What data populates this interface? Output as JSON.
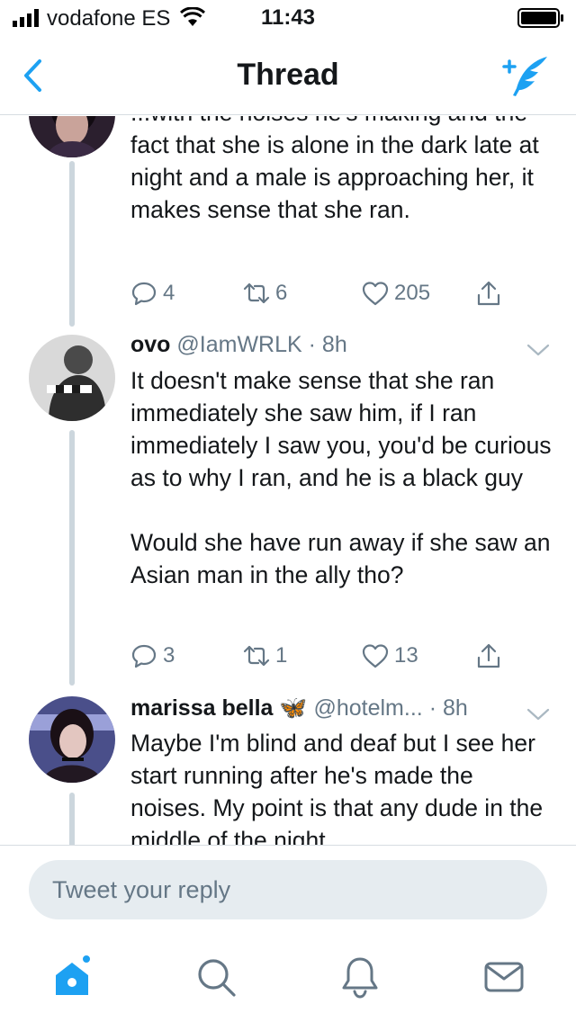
{
  "status_bar": {
    "carrier": "vodafone ES",
    "time": "11:43"
  },
  "nav": {
    "title": "Thread",
    "back_icon": "chevron-left-icon",
    "compose_icon": "compose-tweet-icon"
  },
  "tweets": [
    {
      "text": [
        "...with the noises he's making and the fact that she is alone in the dark late at night and a male is approaching her, it makes sense that she ran."
      ],
      "replies": "4",
      "retweets": "6",
      "likes": "205"
    },
    {
      "name": "ovo",
      "handle": "@IamWRLK",
      "time": "· 8h",
      "text": [
        "It doesn't make sense that she ran immediately she saw him, if I ran immediately I saw you, you'd be curious as to why I ran, and he is a black guy",
        "Would she have run away if she saw an Asian man in the ally tho?"
      ],
      "replies": "3",
      "retweets": "1",
      "likes": "13"
    },
    {
      "name": "marissa bella 🦋",
      "handle": "@hotelm...",
      "time": "· 8h",
      "text": [
        "Maybe I'm blind and deaf but I see her start running after he's made the noises. My point is that any dude in the middle of the night"
      ]
    }
  ],
  "reply": {
    "placeholder": "Tweet your reply"
  },
  "tab_bar": {
    "items": [
      "home-icon",
      "search-icon",
      "notifications-icon",
      "messages-icon"
    ],
    "active": "home-icon"
  },
  "colors": {
    "accent": "#1da1f2",
    "text": "#14171a",
    "secondary": "#657786",
    "thread_line": "#ccd6dd",
    "like_heart": "#657786"
  }
}
